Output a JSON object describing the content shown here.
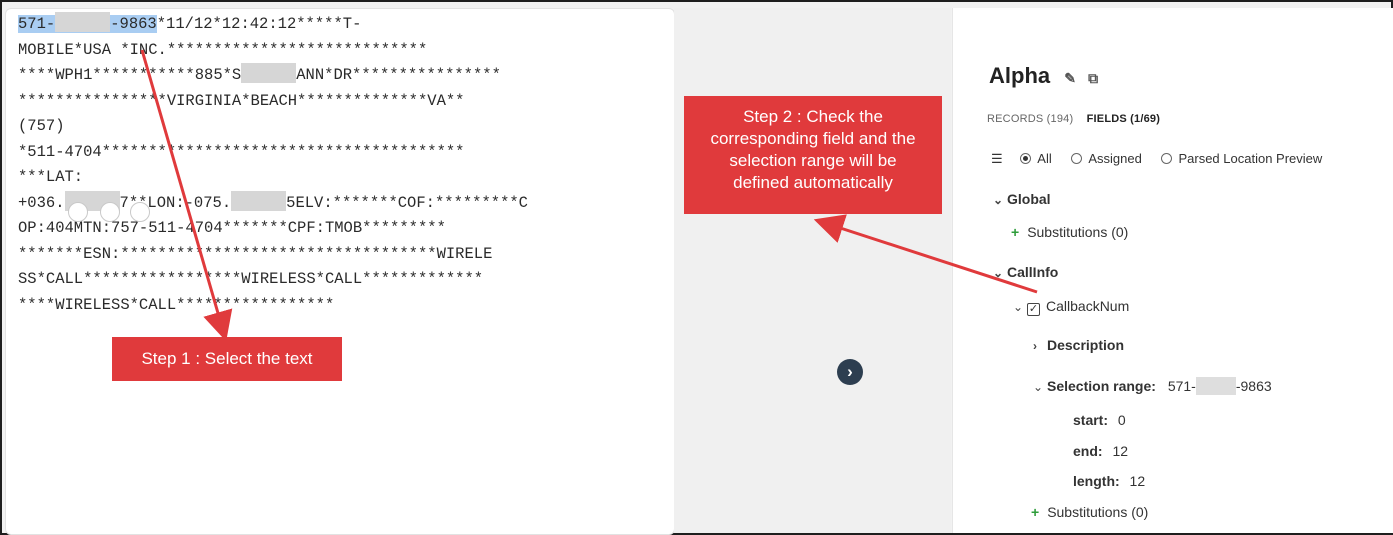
{
  "text_pane": {
    "selected": "571-",
    "selected_end": "-9863",
    "line1_rest": "*11/12*12:42:12*****T-",
    "line2": "MOBILE*USA *INC.****************************",
    "line3a": "****WPH1***********885*S",
    "line3b": "ANN*DR****************",
    "line4": "****************VIRGINIA*BEACH**************VA**",
    "line5": "(757)",
    "line6": "*511-4704***************************************",
    "line7": "***LAT:",
    "line8a": "+036.",
    "line8b": "7**LON:-075.",
    "line8c": "5ELV:*******COF:*********C",
    "line9": "OP:404MTN:757-511-4704*******CPF:TMOB*********",
    "line10": "*******ESN:**********************************WIRELE",
    "line11": "SS*CALL*****************WIRELESS*CALL*************",
    "line12": "****WIRELESS*CALL*****************"
  },
  "callouts": {
    "step1": "Step 1 : Select the text",
    "step2_line1": "Step 2 : Check the",
    "step2_line2": "corresponding field and the",
    "step2_line3": "selection range will be",
    "step2_line4": "defined automatically"
  },
  "next_button": "›",
  "panel": {
    "title": "Alpha",
    "tab_records": "RECORDS (194)",
    "tab_fields": "FIELDS (1/69)",
    "filter_all": "All",
    "filter_assigned": "Assigned",
    "filter_parsed": "Parsed Location Preview",
    "group_global": "Global",
    "global_substitutions": "Substitutions (0)",
    "group_callinfo": "CallInfo",
    "field_callback": "CallbackNum",
    "description": "Description",
    "selection_range_label": "Selection range:",
    "selection_range_start": "571-",
    "selection_range_end": "-9863",
    "start_label": "start:",
    "start_value": "0",
    "end_label": "end:",
    "end_value": "12",
    "length_label": "length:",
    "length_value": "12",
    "callinfo_substitutions": "Substitutions (0)"
  },
  "colors": {
    "callout_red": "#e03a3c",
    "selection_blue": "#a9cdf2",
    "plus_green": "#2e9c3a"
  }
}
